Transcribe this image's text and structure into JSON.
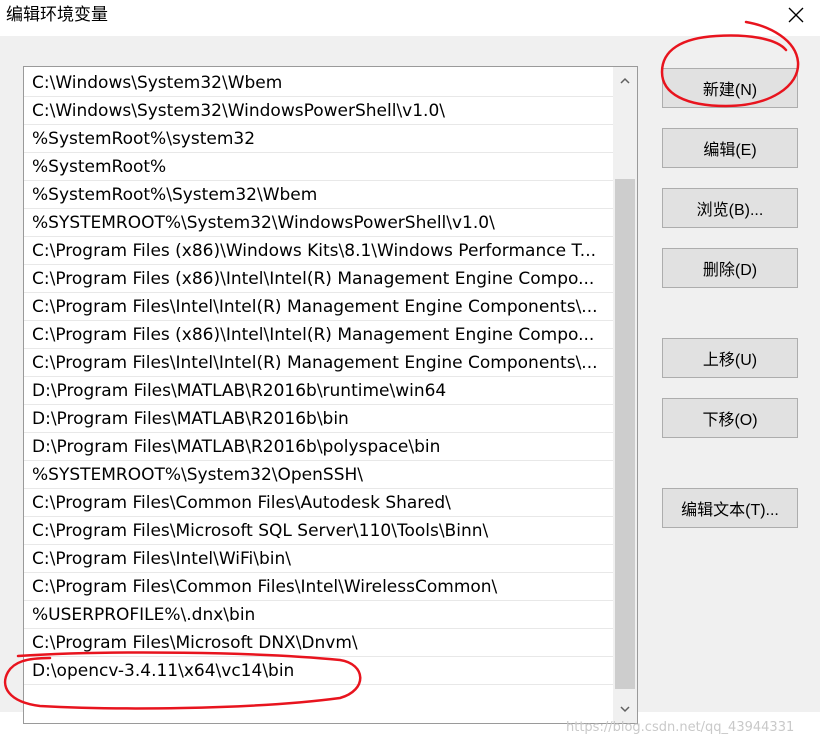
{
  "window": {
    "title": "编辑环境变量",
    "close_icon": "close-icon"
  },
  "path_list": [
    "C:\\Windows\\System32\\Wbem",
    "C:\\Windows\\System32\\WindowsPowerShell\\v1.0\\",
    "%SystemRoot%\\system32",
    "%SystemRoot%",
    "%SystemRoot%\\System32\\Wbem",
    "%SYSTEMROOT%\\System32\\WindowsPowerShell\\v1.0\\",
    "C:\\Program Files (x86)\\Windows Kits\\8.1\\Windows Performance T...",
    "C:\\Program Files (x86)\\Intel\\Intel(R) Management Engine Compo...",
    "C:\\Program Files\\Intel\\Intel(R) Management Engine Components\\...",
    "C:\\Program Files (x86)\\Intel\\Intel(R) Management Engine Compo...",
    "C:\\Program Files\\Intel\\Intel(R) Management Engine Components\\...",
    "D:\\Program Files\\MATLAB\\R2016b\\runtime\\win64",
    "D:\\Program Files\\MATLAB\\R2016b\\bin",
    "D:\\Program Files\\MATLAB\\R2016b\\polyspace\\bin",
    "%SYSTEMROOT%\\System32\\OpenSSH\\",
    "C:\\Program Files\\Common Files\\Autodesk Shared\\",
    "C:\\Program Files\\Microsoft SQL Server\\110\\Tools\\Binn\\",
    "C:\\Program Files\\Intel\\WiFi\\bin\\",
    "C:\\Program Files\\Common Files\\Intel\\WirelessCommon\\",
    "%USERPROFILE%\\.dnx\\bin",
    "C:\\Program Files\\Microsoft DNX\\Dnvm\\",
    "D:\\opencv-3.4.11\\x64\\vc14\\bin"
  ],
  "buttons": {
    "new": "新建(N)",
    "edit": "编辑(E)",
    "browse": "浏览(B)...",
    "delete": "删除(D)",
    "move_up": "上移(U)",
    "move_down": "下移(O)",
    "edit_text": "编辑文本(T)..."
  },
  "watermark": "https://blog.csdn.net/qq_43944331",
  "colors": {
    "annotation_red": "#e8141e",
    "dialog_bg": "#f0f0f0",
    "button_bg": "#e1e1e1",
    "scroll_thumb": "#cdcdcd"
  }
}
